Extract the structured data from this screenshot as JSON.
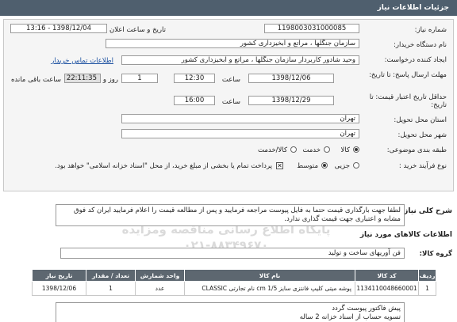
{
  "header": {
    "title": "جزئیات اطلاعات نیاز"
  },
  "form": {
    "need_number_label": "شماره نیاز:",
    "need_number": "1198003031000085",
    "announce_label": "تاریخ و ساعت اعلان عمومی:",
    "announce_value": "1398/12/04 - 13:16",
    "buyer_org_label": "نام دستگاه خریدار:",
    "buyer_org": "سازمان جنگلها ، مراتع و آبخیزداری کشور",
    "creator_label": "ایجاد کننده درخواست:",
    "creator": "وحید  شادور کاربردار سازمان جنگلها ، مراتع و آبخیزداری کشور",
    "contact_link": "اطلاعات تماس خریدار",
    "reply_deadline_label": "مهلت ارسال پاسخ: تا تاریخ:",
    "reply_date": "1398/12/06",
    "time_label": "ساعت",
    "reply_time": "12:30",
    "days": "1",
    "days_label": "روز و",
    "remaining_time": "22:11:35",
    "remaining_label": "ساعت باقی مانده",
    "price_validity_label": "حداقل تاریخ اعتبار قیمت: تا تاریخ:",
    "price_date": "1398/12/29",
    "price_time": "16:00",
    "province_label": "استان محل تحویل:",
    "province": "تهران",
    "city_label": "شهر محل تحویل:",
    "city": "تهران",
    "category_label": "طبقه بندی موضوعی:",
    "category_options": [
      "کالا",
      "خدمت",
      "کالا/خدمت"
    ],
    "process_label": "نوع فرآیند خرید :",
    "process_options": [
      "جزیی",
      "متوسط"
    ],
    "payment_note": "پرداخت تمام یا بخشی از مبلغ خرید، از محل \"اسناد خزانه اسلامی\" خواهد بود."
  },
  "description": {
    "label": "شرح کلی نیاز:",
    "text": "لطفا جهت بارگذاری قیمت حتما به فایل پیوست مراجعه فرمایید و پس از مطالعه قیمت را اعلام فرمایید ایران کد فوق مشابه و اعتباری جهت قیمت گذاری ندارد."
  },
  "goods": {
    "section_title": "اطلاعات کالاهای مورد نیاز",
    "group_label": "گروه کالا:",
    "group_value": "فن آوریهای ساخت و تولید",
    "columns": [
      "ردیف",
      "کد کالا",
      "نام کالا",
      "واحد شمارش",
      "تعداد / مقدار",
      "تاریخ نیاز"
    ],
    "rows": [
      [
        "1",
        "1134110048660001",
        "پوشه میتی کلیپ فانتزی سایز cm 1/5 نام تجارتی CLASSIC",
        "عدد",
        "1",
        "1398/12/06"
      ]
    ]
  },
  "notes": {
    "lines": [
      "پیش فاکتور پیوست گردد",
      "تسویه حساب از اسناد خزانه 2 ساله"
    ]
  },
  "watermark": {
    "line1": "مرکز فرآوری اطلاعات مناقصه و مزایده",
    "line2": "پایگاه اطلاع رسانی مناقصه ومزایده",
    "phone": "۰۲۱-۸۸۳۴۹۶۷۰"
  }
}
